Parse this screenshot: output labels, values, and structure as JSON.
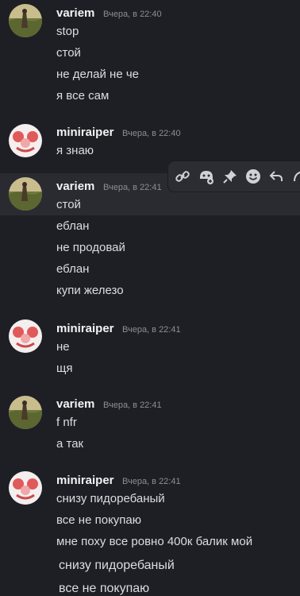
{
  "messages": [
    {
      "author": "variem",
      "timestamp": "Вчера, в 22:40",
      "avatar": "landscape-avatar",
      "lines": [
        "stop",
        "стой",
        "не делай не че",
        "я все сам"
      ]
    },
    {
      "author": "miniraiper",
      "timestamp": "Вчера, в 22:40",
      "avatar": "clown-avatar",
      "lines": [
        "я  знаю"
      ]
    },
    {
      "author": "variem",
      "timestamp": "Вчера, в 22:41",
      "avatar": "landscape-avatar",
      "lines": [
        "стой",
        "еблан",
        "не продовай",
        "еблан",
        "купи железо"
      ]
    },
    {
      "author": "miniraiper",
      "timestamp": "Вчера, в 22:41",
      "avatar": "clown-avatar",
      "lines": [
        "не",
        "щя"
      ]
    },
    {
      "author": "variem",
      "timestamp": "Вчера, в 22:41",
      "avatar": "landscape-avatar",
      "lines": [
        "f nfr",
        "а так"
      ]
    },
    {
      "author": "miniraiper",
      "timestamp": "Вчера, в 22:41",
      "avatar": "clown-avatar",
      "lines": [
        "снизу пидоребаный",
        "все не покупаю",
        "мне поху все ровно 400к балик мой",
        "снизу пидоребаный",
        "все не покупаю"
      ]
    }
  ],
  "toolbar": {
    "icons": [
      "link-icon",
      "add-reaction-icon",
      "pin-icon",
      "emoji-icon",
      "reply-icon",
      "more-icon"
    ]
  },
  "colors": {
    "background": "#1e1f24",
    "hover": "#2a2b31",
    "toolbar": "#2b2d33",
    "author": "#f2f3f5",
    "text": "#dcdde1",
    "timestamp": "#8a8e97"
  }
}
